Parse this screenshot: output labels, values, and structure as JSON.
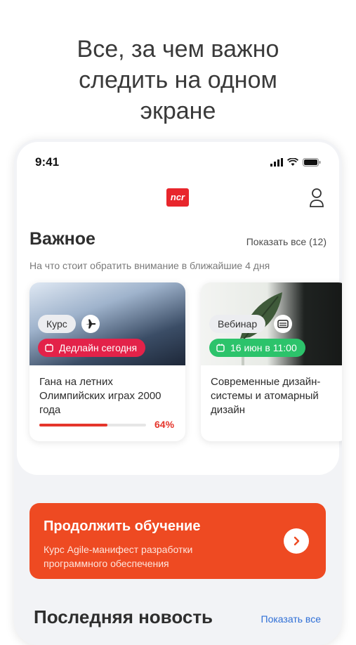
{
  "headline": [
    "Все, за чем важно",
    "следить на одном",
    "экране"
  ],
  "status_bar": {
    "time": "9:41"
  },
  "app": {
    "logo_text": "ncr"
  },
  "important": {
    "title": "Важное",
    "show_all": "Показать все (12)",
    "subtitle": "На что стоит обратить внимание в ближайшие 4 дня",
    "cards": [
      {
        "tag": "Курс",
        "icon": "plane-icon",
        "deadline": "Дедлайн сегодня",
        "title": "Гана на летних Олимпийских играх 2000 года",
        "progress_percent": 64,
        "progress_label": "64%",
        "deadline_color": "#e32249"
      },
      {
        "tag": "Вебинар",
        "icon": "ticket-icon",
        "deadline": "16 июн в 11:00",
        "title": "Современные дизайн-системы и атомарный дизайн",
        "deadline_color": "#2cc36b"
      }
    ]
  },
  "continue": {
    "title": "Продолжить  обучение",
    "subtitle": "Курс Agile-манифест разработки программного обеспечения",
    "color": "#ee4a22"
  },
  "news": {
    "title": "Последняя новость",
    "show_all": "Показать все"
  }
}
